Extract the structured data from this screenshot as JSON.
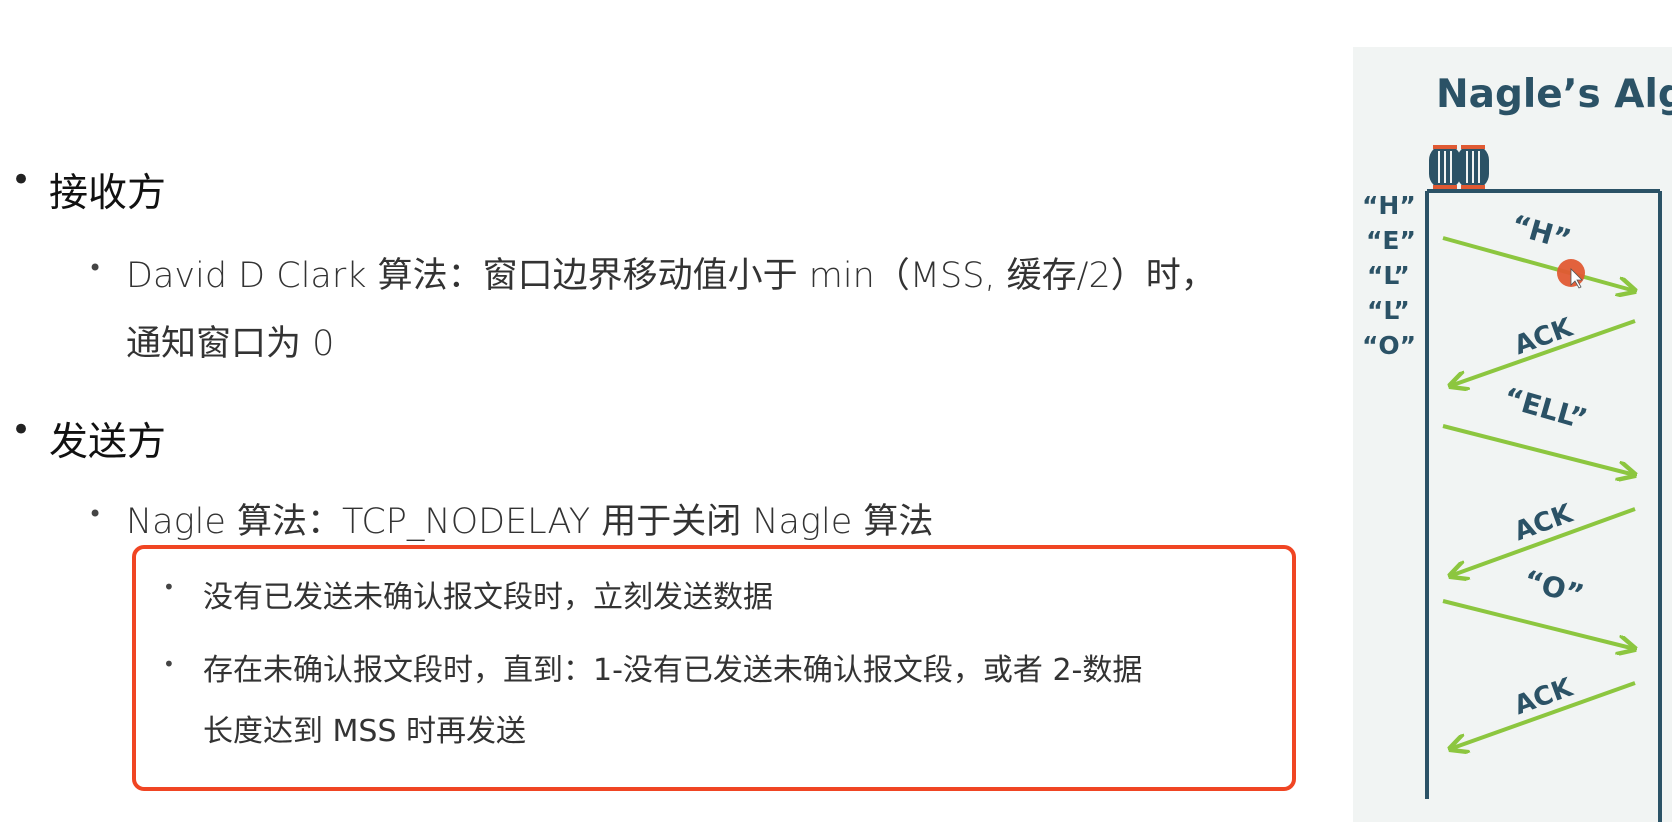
{
  "receiver": {
    "heading": "接收方",
    "item": {
      "line1": "David D Clark 算法：窗口边界移动值小于 min（MSS, 缓存/2）时，",
      "line2": "通知窗口为 0"
    }
  },
  "sender": {
    "heading": "发送方",
    "item": "Nagle 算法：TCP_NODELAY 用于关闭 Nagle 算法",
    "rules": {
      "rule1": "没有已发送未确认报文段时，立刻发送数据",
      "rule2_line1": "存在未确认报文段时，直到：1-没有已发送未确认报文段，或者 2-数据",
      "rule2_line2": "长度达到 MSS 时再发送"
    }
  },
  "diagram": {
    "title": "Nagle’s Alg",
    "queue_chars": [
      "“H”",
      "“E”",
      "“L”",
      "“L”",
      "“O”"
    ],
    "packets": [
      "“H”",
      "“ELL”",
      "“O”"
    ],
    "ack_label": "ACK",
    "colors": {
      "arrow": "#8cc63f",
      "line": "#2b5266",
      "text": "#2b5266",
      "accent": "#e05a33",
      "panel": "#f1f4f3"
    }
  }
}
